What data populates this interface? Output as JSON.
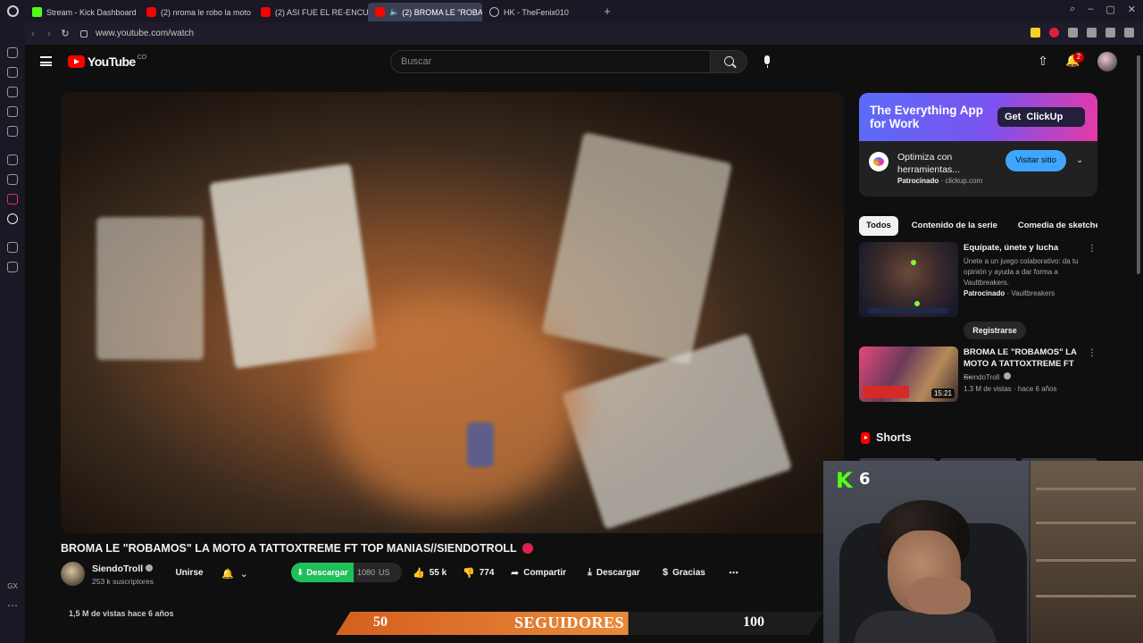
{
  "browser": {
    "tabs": [
      {
        "label": "Stream - Kick Dashboard",
        "favicon": "kick"
      },
      {
        "label": "(2) nroma le robo la moto",
        "favicon": "yt"
      },
      {
        "label": "(2) ASI FUE EL RE-ENCU",
        "favicon": "yt"
      },
      {
        "label": "(2) BROMA LE \"ROBA",
        "favicon": "yt",
        "active": true
      },
      {
        "label": "HK - TheFenix010",
        "favicon": "globe"
      }
    ],
    "url": "www.youtube.com/watch"
  },
  "youtube": {
    "logo_text": "YouTube",
    "logo_country": "CO",
    "search_placeholder": "Buscar",
    "notifications": "2"
  },
  "video": {
    "title": "BROMA LE \"ROBAMOS\" LA MOTO A TATTOXTREME FT TOP MANIAS//SIENDOTROLL",
    "channel": "SiendoTroll",
    "subscribers": "253 k suscriptores",
    "join_label": "Unirse",
    "download_ext_label": "Descargar",
    "download_quality": "1080",
    "download_unit": "US",
    "likes": "55 k",
    "dislikes": "774",
    "share_label": "Compartir",
    "download_label": "Descargar",
    "thanks_label": "Gracias",
    "views_line": "1,5 M de vistas  hace 6 años"
  },
  "ad": {
    "banner_headline": "The Everything App for Work",
    "banner_cta": "Get",
    "banner_brand": "ClickUp",
    "title": "Optimiza con herramientas...",
    "sponsored": "Patrocinado",
    "domain": "clickup.com",
    "visit_label": "Visitar sitio"
  },
  "chips": [
    "Todos",
    "Contenido de la serie",
    "Comedia de sketches"
  ],
  "recommendations": [
    {
      "title": "Equípate, únete y lucha",
      "description": "Únete a un juego colaborativo: da tu opinión y ayuda a dar forma a Vaultbreakers.",
      "sponsored": "Patrocinado",
      "advertiser": "Vaultbreakers",
      "cta": "Registrarse"
    },
    {
      "title": "BROMA LE \"ROBAMOS\" LA MOTO A TATTOXTREME FT ...",
      "channel": "SiendoTroll",
      "meta": "1.3 M de vistas · hace 6 años",
      "duration": "15:21"
    }
  ],
  "shorts_label": "Shorts",
  "stream_overlay": {
    "viewer_count": "6",
    "goal_start": "50",
    "goal_label": "SEGUIDORES",
    "goal_end": "100",
    "goal_progress": 0.6,
    "brand_color": "#53fc18"
  }
}
